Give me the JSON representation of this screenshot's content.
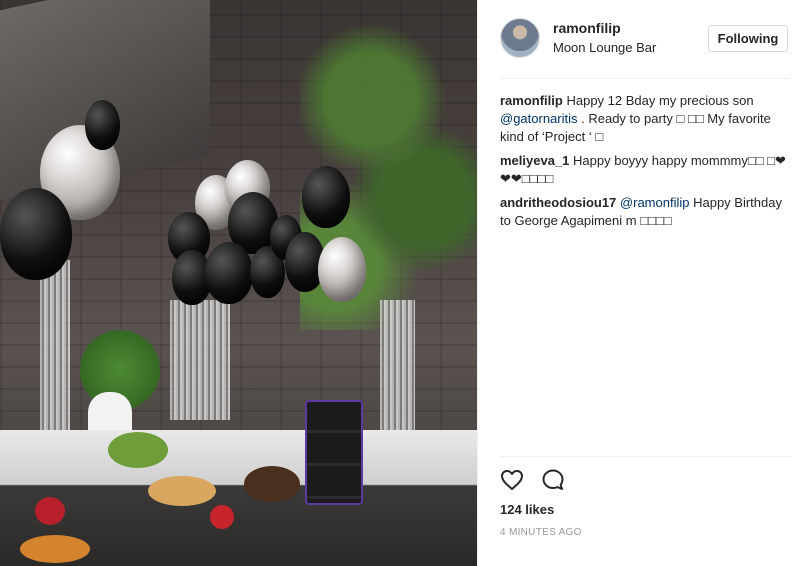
{
  "post": {
    "author": "ramonfilip",
    "location": "Moon Lounge Bar",
    "follow_label": "Following",
    "likes": "124 likes",
    "time": "4 MINUTES AGO"
  },
  "comments": [
    {
      "user": "ramonfilip",
      "parts": [
        "Happy 12 Bday my precious son ",
        "@gatornaritis",
        " . Ready to party □ □□ My favorite kind of ‘Project ‘ □"
      ]
    },
    {
      "user": "meliyeva_1",
      "parts": [
        "Happy boyyy happy mommmy□□ □❤❤❤□□□□"
      ]
    },
    {
      "user": "andritheodosiou17",
      "parts": [
        "",
        "@ramonfilip",
        " Happy Birthday to George Agapimeni m □□□□"
      ]
    }
  ],
  "icons": {
    "like": "heart-icon",
    "comment": "comment-bubble-icon"
  },
  "colors": {
    "mention": "#003569",
    "text": "#262626",
    "muted": "#999999"
  }
}
